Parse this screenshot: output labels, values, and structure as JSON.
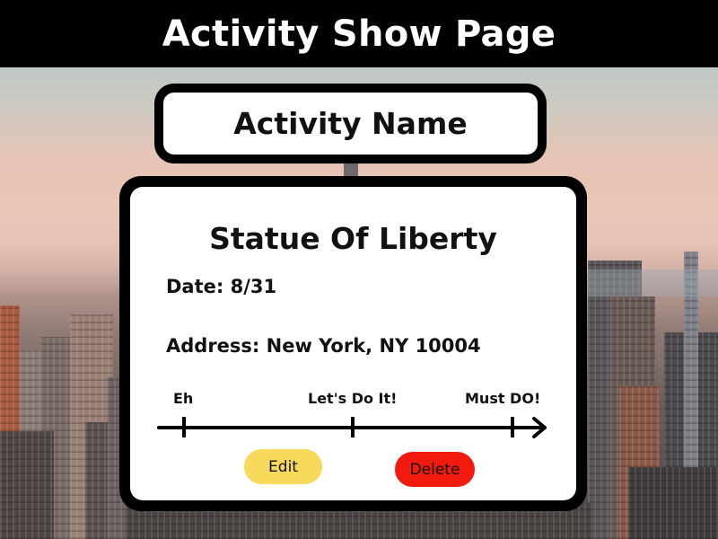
{
  "header": {
    "title": "Activity Show Page"
  },
  "activity_name_label": "Activity Name",
  "activity": {
    "name": "Statue Of Liberty",
    "date_label": "Date: 8/31",
    "address_label": "Address: New York, NY 10004"
  },
  "rating_scale": {
    "labels": [
      "Eh",
      "Let's Do It!",
      "Must DO!"
    ]
  },
  "actions": {
    "edit_label": "Edit",
    "delete_label": "Delete"
  },
  "colors": {
    "header_bg": "#000000",
    "edit_button": "#f7d95b",
    "delete_button": "#f2190f"
  }
}
